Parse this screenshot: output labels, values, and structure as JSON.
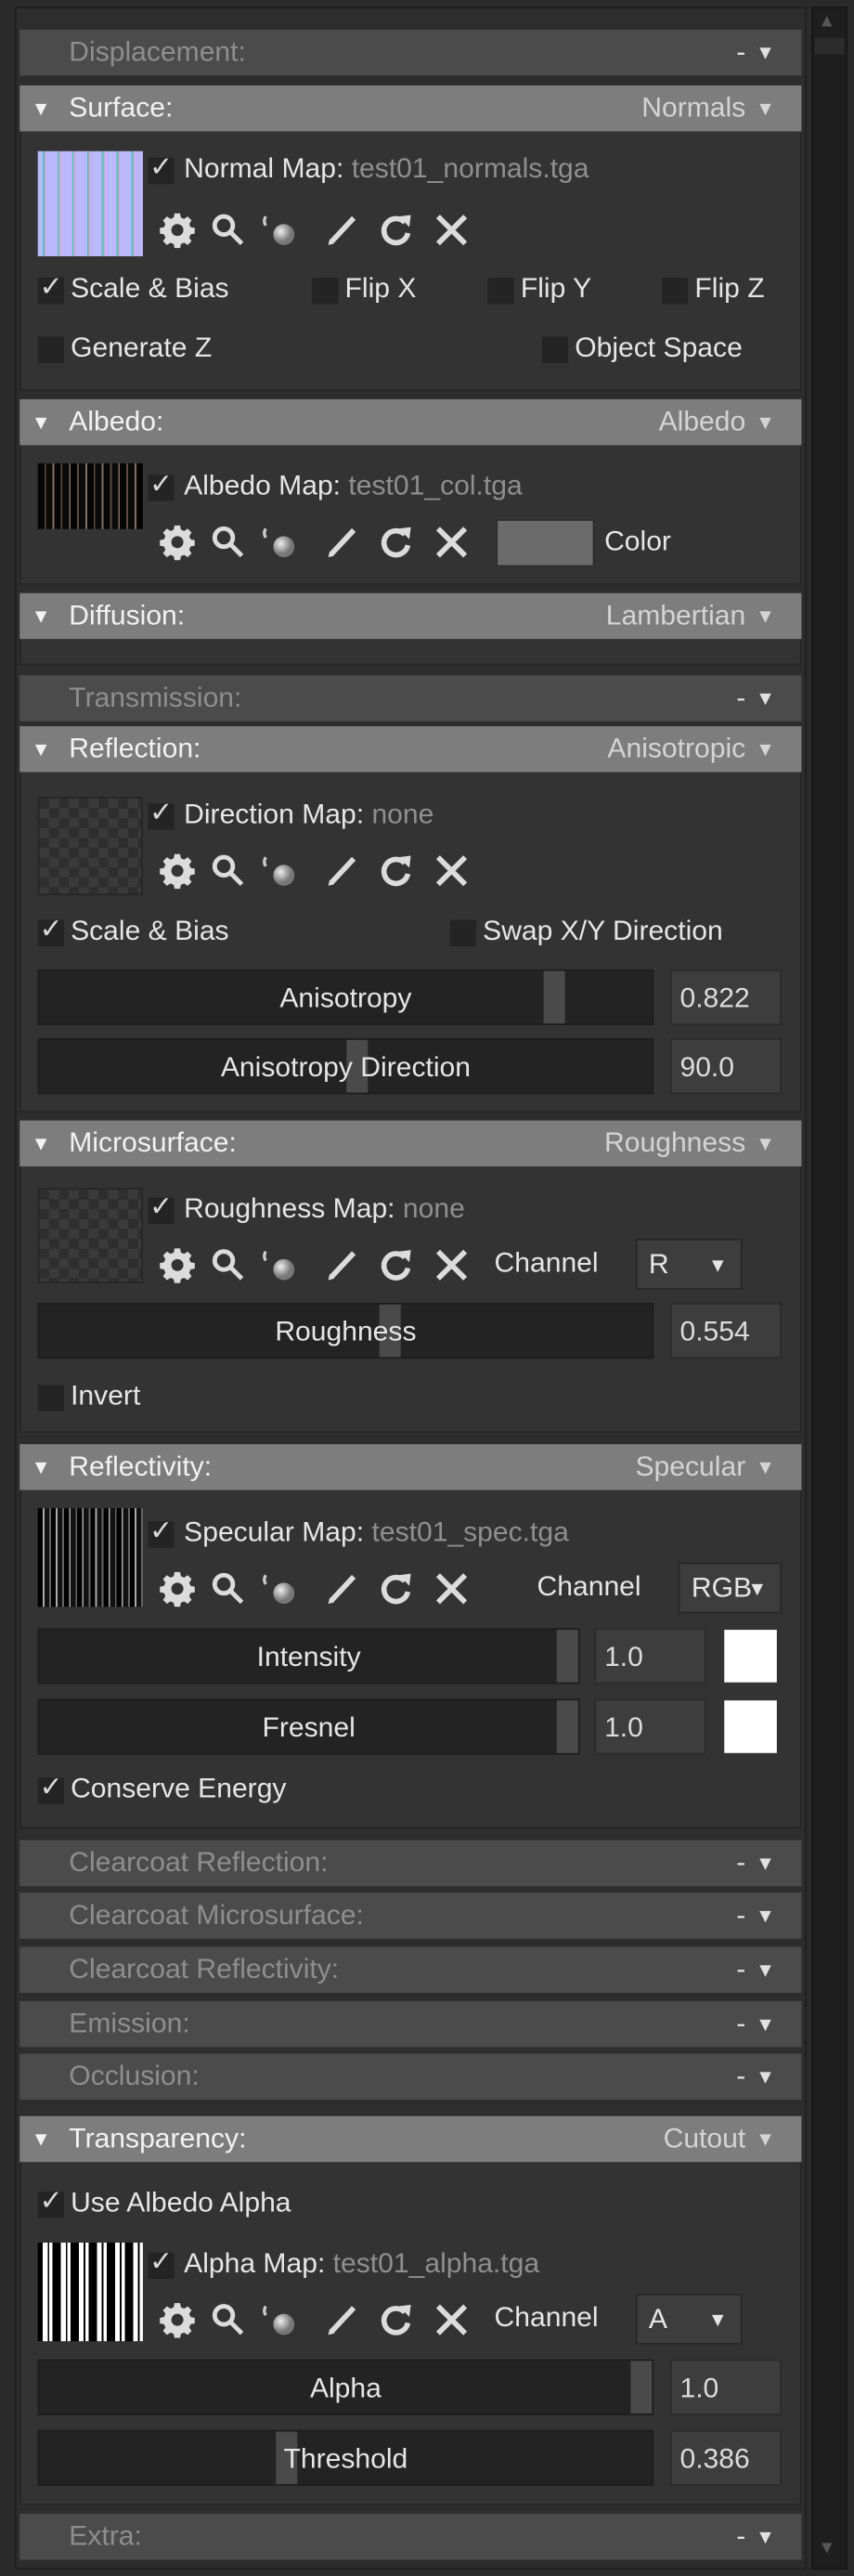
{
  "sections": {
    "displacement": {
      "label": "Displacement:",
      "value": "-"
    },
    "surface": {
      "label": "Surface:",
      "value": "Normals",
      "map": {
        "enabled": true,
        "label": "Normal Map:",
        "file": "test01_normals.tga"
      },
      "options": [
        {
          "label": "Scale & Bias",
          "checked": true
        },
        {
          "label": "Flip X",
          "checked": false
        },
        {
          "label": "Flip Y",
          "checked": false
        },
        {
          "label": "Flip Z",
          "checked": false
        },
        {
          "label": "Generate Z",
          "checked": false
        },
        {
          "label": "Object Space",
          "checked": false
        }
      ]
    },
    "albedo": {
      "label": "Albedo:",
      "value": "Albedo",
      "map": {
        "enabled": true,
        "label": "Albedo Map:",
        "file": "test01_col.tga"
      },
      "color_label": "Color",
      "color": "#6b6b6b"
    },
    "diffusion": {
      "label": "Diffusion:",
      "value": "Lambertian"
    },
    "transmission": {
      "label": "Transmission:",
      "value": "-"
    },
    "reflection": {
      "label": "Reflection:",
      "value": "Anisotropic",
      "map": {
        "enabled": true,
        "label": "Direction Map:",
        "file": "none"
      },
      "options": [
        {
          "label": "Scale & Bias",
          "checked": true
        },
        {
          "label": "Swap X/Y Direction",
          "checked": false
        }
      ],
      "sliders": [
        {
          "label": "Anisotropy",
          "value": "0.822",
          "fraction": 0.822
        },
        {
          "label": "Anisotropy Direction",
          "value": "90.0",
          "fraction": 0.5
        }
      ]
    },
    "microsurface": {
      "label": "Microsurface:",
      "value": "Roughness",
      "map": {
        "enabled": true,
        "label": "Roughness Map:",
        "file": "none"
      },
      "channel_label": "Channel",
      "channel": "R",
      "sliders": [
        {
          "label": "Roughness",
          "value": "0.554",
          "fraction": 0.554
        }
      ],
      "options": [
        {
          "label": "Invert",
          "checked": false
        }
      ]
    },
    "reflectivity": {
      "label": "Reflectivity:",
      "value": "Specular",
      "map": {
        "enabled": true,
        "label": "Specular Map:",
        "file": "test01_spec.tga"
      },
      "channel_label": "Channel",
      "channel": "RGB",
      "sliders": [
        {
          "label": "Intensity",
          "value": "1.0",
          "fraction": 1.0,
          "color": "#ffffff"
        },
        {
          "label": "Fresnel",
          "value": "1.0",
          "fraction": 1.0,
          "color": "#ffffff"
        }
      ],
      "options": [
        {
          "label": "Conserve Energy",
          "checked": true
        }
      ]
    },
    "clearcoat_reflection": {
      "label": "Clearcoat Reflection:",
      "value": "-"
    },
    "clearcoat_microsurface": {
      "label": "Clearcoat Microsurface:",
      "value": "-"
    },
    "clearcoat_reflectivity": {
      "label": "Clearcoat Reflectivity:",
      "value": "-"
    },
    "emission": {
      "label": "Emission:",
      "value": "-"
    },
    "occlusion": {
      "label": "Occlusion:",
      "value": "-"
    },
    "transparency": {
      "label": "Transparency:",
      "value": "Cutout",
      "options": [
        {
          "label": "Use Albedo Alpha",
          "checked": true
        }
      ],
      "map": {
        "enabled": true,
        "label": "Alpha Map:",
        "file": "test01_alpha.tga"
      },
      "channel_label": "Channel",
      "channel": "A",
      "sliders": [
        {
          "label": "Alpha",
          "value": "1.0",
          "fraction": 1.0
        },
        {
          "label": "Threshold",
          "value": "0.386",
          "fraction": 0.386
        }
      ]
    },
    "extra": {
      "label": "Extra:",
      "value": "-"
    }
  },
  "map_tools": [
    "gear-icon",
    "search-icon",
    "material-sphere-icon",
    "pencil-icon",
    "refresh-icon",
    "close-icon"
  ],
  "colors": {
    "header_expanded": "#7d7d7d",
    "header_collapsed": "#4b4b4b",
    "panel": "#333333"
  }
}
